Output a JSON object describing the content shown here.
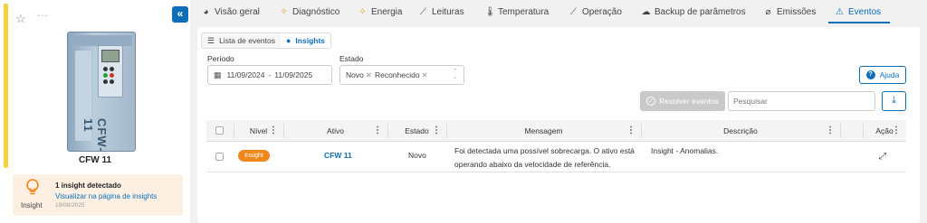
{
  "left_panel": {
    "device_name": "CFW 11",
    "device_brand": "CFW-11",
    "more": "···",
    "insight": {
      "label": "Insight",
      "title": "1 insight detectado",
      "link": "Visualizar na página de insights",
      "date": "19/08/2025"
    }
  },
  "tabs": [
    {
      "label": "Visão geral",
      "icon": "pie-icon"
    },
    {
      "label": "Diagnóstico",
      "icon": "diagnostic-icon"
    },
    {
      "label": "Energia",
      "icon": "energy-icon"
    },
    {
      "label": "Leituras",
      "icon": "chart-icon"
    },
    {
      "label": "Temperatura",
      "icon": "thermometer-icon"
    },
    {
      "label": "Operação",
      "icon": "operation-chart-icon"
    },
    {
      "label": "Backup de parâmetros",
      "icon": "cloud-icon"
    },
    {
      "label": "Emissões",
      "icon": "leaf-icon"
    },
    {
      "label": "Eventos",
      "icon": "warning-icon",
      "active": true
    }
  ],
  "view_toggle": {
    "list_label": "Lista de eventos",
    "insights_label": "Insights",
    "active": "insights"
  },
  "filters": {
    "period_label": "Período",
    "period_start": "11/09/2024",
    "period_sep": "-",
    "period_end": "11/09/2025",
    "state_label": "Estado",
    "state_chips": [
      "Novo",
      "Reconhecido"
    ]
  },
  "toolbar": {
    "help_label": "Ajuda",
    "resolve_label": "Resolver eventos",
    "search_placeholder": "Pesquisar"
  },
  "table": {
    "headers": {
      "level": "Nível",
      "asset": "Ativo",
      "state": "Estado",
      "message": "Mensagem",
      "description": "Descrição",
      "action": "Ação"
    },
    "rows": [
      {
        "level": "Insight",
        "asset": "CFW 11",
        "state": "Novo",
        "message_line1": "Foi detectada uma possível sobrecarga. O ativo está",
        "message_line2": "operando abaixo da velocidade de referência.",
        "description": "Insight - Anomalias."
      }
    ]
  },
  "colors": {
    "accent": "#0d6fb8",
    "insight_badge": "#f0871a",
    "highlight_bar": "#f7d13a",
    "insight_card_bg": "#fdf0e3"
  }
}
